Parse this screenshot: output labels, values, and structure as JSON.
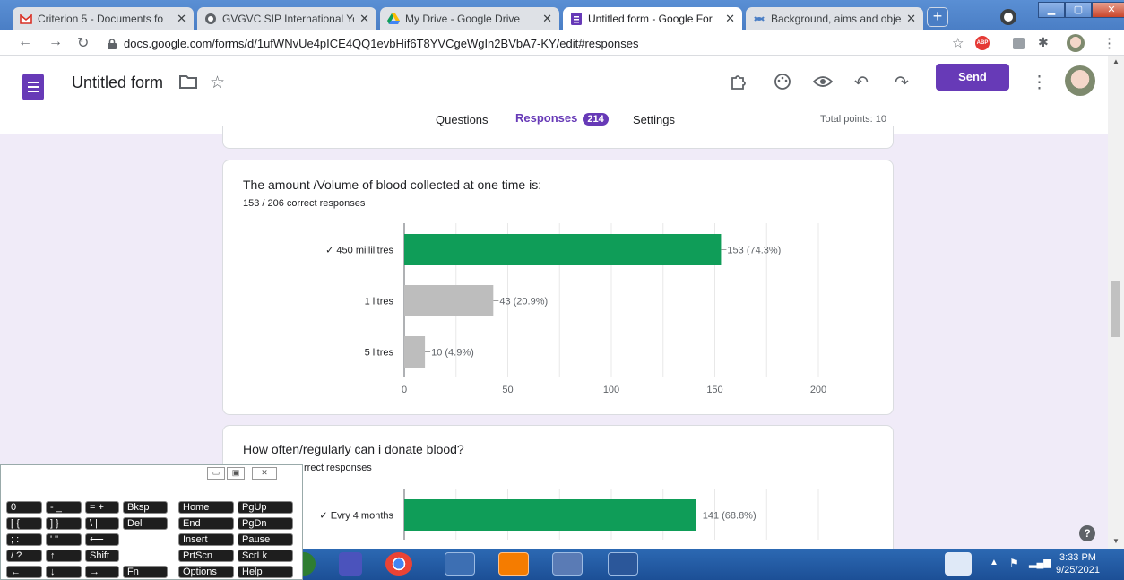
{
  "browser": {
    "tabs": [
      {
        "title": "Criterion 5 - Documents fo",
        "icon": "gmail-icon"
      },
      {
        "title": "GVGVC SIP International Yo",
        "icon": "globe-icon"
      },
      {
        "title": "My Drive - Google Drive",
        "icon": "drive-icon"
      },
      {
        "title": "Untitled form - Google For",
        "icon": "forms-icon",
        "active": true
      },
      {
        "title": "Background, aims and obje",
        "icon": "link-icon"
      }
    ],
    "new_tab": "+",
    "url": "docs.google.com/forms/d/1ufWNvUe4pICE4QQ1evbHif6T8YVCgeWgIn2BVbA7-KY/edit#responses",
    "ext_abp": "ABP"
  },
  "form": {
    "title": "Untitled form",
    "send_label": "Send",
    "tabs": {
      "questions": "Questions",
      "responses": "Responses",
      "responses_count": "214",
      "settings": "Settings"
    },
    "total_points": "Total points: 10"
  },
  "questions": [
    {
      "title": "The amount /Volume of blood collected at one time is:",
      "summary": "153 / 206 correct responses"
    },
    {
      "title": "How often/regularly can i donate blood?",
      "summary": "rrect responses"
    }
  ],
  "chart_data": [
    {
      "type": "bar",
      "orientation": "horizontal",
      "categories": [
        "✓ 450 millilitres",
        "1 litres",
        "5 litres"
      ],
      "values": [
        153,
        43,
        10
      ],
      "labels": [
        "153 (74.3%)",
        "43 (20.9%)",
        "10 (4.9%)"
      ],
      "correct": [
        true,
        false,
        false
      ],
      "colors": [
        "#0f9d58",
        "#bdbdbd",
        "#bdbdbd"
      ],
      "xticks": [
        0,
        50,
        100,
        150,
        200
      ],
      "xlim": [
        0,
        200
      ],
      "grid": true
    },
    {
      "type": "bar",
      "orientation": "horizontal",
      "categories": [
        "✓ Evry 4 months"
      ],
      "values": [
        141
      ],
      "labels": [
        "141 (68.8%)"
      ],
      "correct": [
        true
      ],
      "colors": [
        "#0f9d58"
      ],
      "xlim": [
        0,
        200
      ],
      "grid": true
    }
  ],
  "osk": {
    "keys": [
      [
        "0",
        "- _",
        "= +",
        "Bksp",
        "Home",
        "PgUp"
      ],
      [
        "[ {",
        "] }",
        "\\ |",
        "Del",
        "End",
        "PgDn"
      ],
      [
        "; :",
        "' \"",
        "⟵",
        "",
        "Insert",
        "Pause"
      ],
      [
        "/ ?",
        "↑",
        "Shift",
        "",
        "PrtScn",
        "ScrLk"
      ],
      [
        "←",
        "↓",
        "→",
        "Fn",
        "Options",
        "Help"
      ]
    ]
  },
  "taskbar": {
    "time": "3:33 PM",
    "date": "9/25/2021"
  }
}
